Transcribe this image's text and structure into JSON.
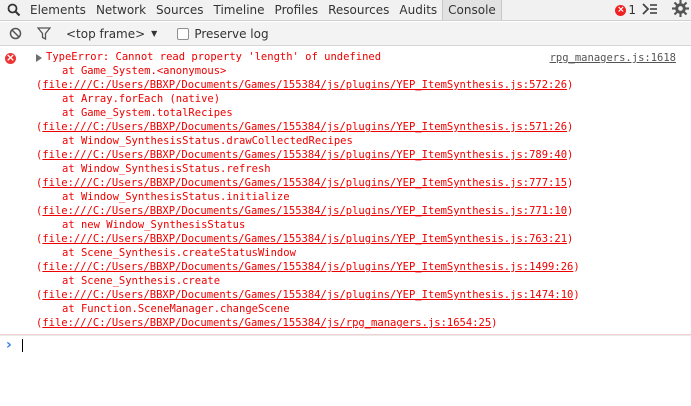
{
  "tabs": [
    {
      "label": "Elements"
    },
    {
      "label": "Network"
    },
    {
      "label": "Sources"
    },
    {
      "label": "Timeline"
    },
    {
      "label": "Profiles"
    },
    {
      "label": "Resources"
    },
    {
      "label": "Audits"
    },
    {
      "label": "Console"
    }
  ],
  "active_tab": "Console",
  "error_count": "1",
  "toolbar": {
    "frame_selector": "<top frame>",
    "preserve_log_label": "Preserve log"
  },
  "message": {
    "headline": "TypeError: Cannot read property 'length' of undefined",
    "source": "rpg_managers.js:1618",
    "stack": [
      {
        "at": "at Game_System.<anonymous>",
        "loc": "file:///C:/Users/BBXP/Documents/Games/155384/js/plugins/YEP_ItemSynthesis.js:572:26"
      },
      {
        "at": "at Array.forEach (native)",
        "loc": ""
      },
      {
        "at": "at Game_System.totalRecipes",
        "loc": "file:///C:/Users/BBXP/Documents/Games/155384/js/plugins/YEP_ItemSynthesis.js:571:26"
      },
      {
        "at": "at Window_SynthesisStatus.drawCollectedRecipes",
        "loc": "file:///C:/Users/BBXP/Documents/Games/155384/js/plugins/YEP_ItemSynthesis.js:789:40"
      },
      {
        "at": "at Window_SynthesisStatus.refresh",
        "loc": "file:///C:/Users/BBXP/Documents/Games/155384/js/plugins/YEP_ItemSynthesis.js:777:15"
      },
      {
        "at": "at Window_SynthesisStatus.initialize",
        "loc": "file:///C:/Users/BBXP/Documents/Games/155384/js/plugins/YEP_ItemSynthesis.js:771:10"
      },
      {
        "at": "at new Window_SynthesisStatus",
        "loc": "file:///C:/Users/BBXP/Documents/Games/155384/js/plugins/YEP_ItemSynthesis.js:763:21"
      },
      {
        "at": "at Scene_Synthesis.createStatusWindow",
        "loc": "file:///C:/Users/BBXP/Documents/Games/155384/js/plugins/YEP_ItemSynthesis.js:1499:26"
      },
      {
        "at": "at Scene_Synthesis.create",
        "loc": "file:///C:/Users/BBXP/Documents/Games/155384/js/plugins/YEP_ItemSynthesis.js:1474:10"
      },
      {
        "at": "at Function.SceneManager.changeScene",
        "loc": "file:///C:/Users/BBXP/Documents/Games/155384/js/rpg_managers.js:1654:25"
      }
    ]
  },
  "colors": {
    "error_text": "#ee0000",
    "prompt": "#367cf1"
  },
  "icons": [
    "search-icon",
    "clear-console-icon",
    "filter-icon",
    "error-icon",
    "drawer-toggle-icon",
    "gear-icon",
    "expand-triangle-icon",
    "prompt-chevron-icon"
  ]
}
